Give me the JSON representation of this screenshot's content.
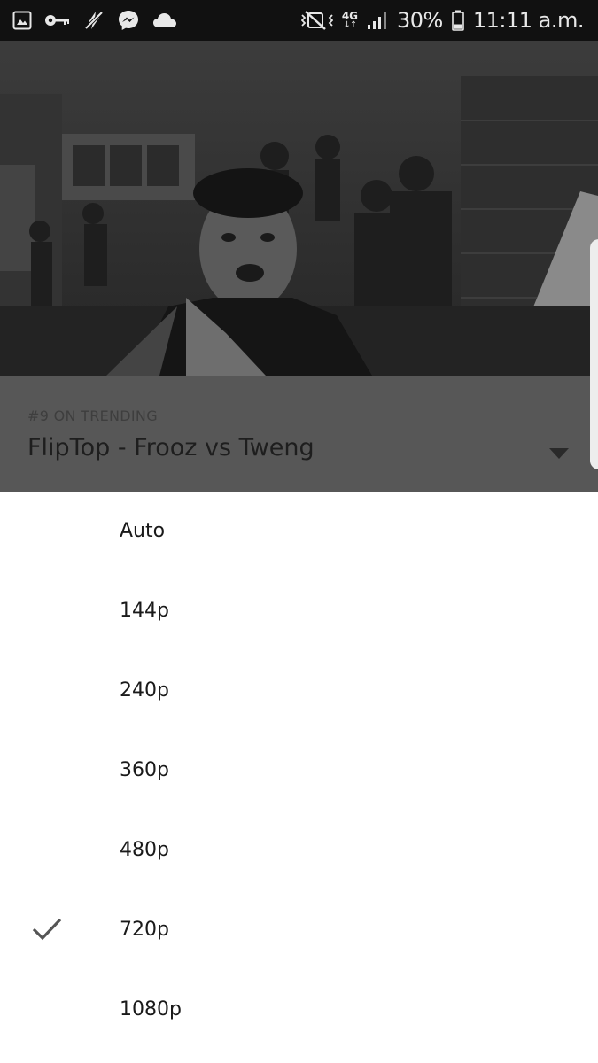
{
  "status_bar": {
    "network_type": "4G",
    "network_arrows": "↓↑",
    "battery_percent": "30%",
    "time": "11:11 a.m."
  },
  "video": {
    "trending_label": "#9 ON TRENDING",
    "title": "FlipTop - Frooz vs Tweng"
  },
  "quality_menu": {
    "options": [
      {
        "label": "Auto",
        "selected": false
      },
      {
        "label": "144p",
        "selected": false
      },
      {
        "label": "240p",
        "selected": false
      },
      {
        "label": "360p",
        "selected": false
      },
      {
        "label": "480p",
        "selected": false
      },
      {
        "label": "720p",
        "selected": true
      },
      {
        "label": "1080p",
        "selected": false
      }
    ]
  },
  "colors": {
    "status_bar": "#111111",
    "dim_overlay": "#575757",
    "sheet_background": "#ffffff",
    "check": "#555555"
  },
  "icons": {
    "status_left": [
      "gallery-icon",
      "key-icon",
      "no-charging-icon",
      "messenger-icon",
      "cloud-icon"
    ],
    "status_right": [
      "mute-icon",
      "network-4g-icon",
      "signal-icon",
      "battery-icon"
    ],
    "selected_marker": "check-icon",
    "expand": "chevron-down-icon"
  }
}
